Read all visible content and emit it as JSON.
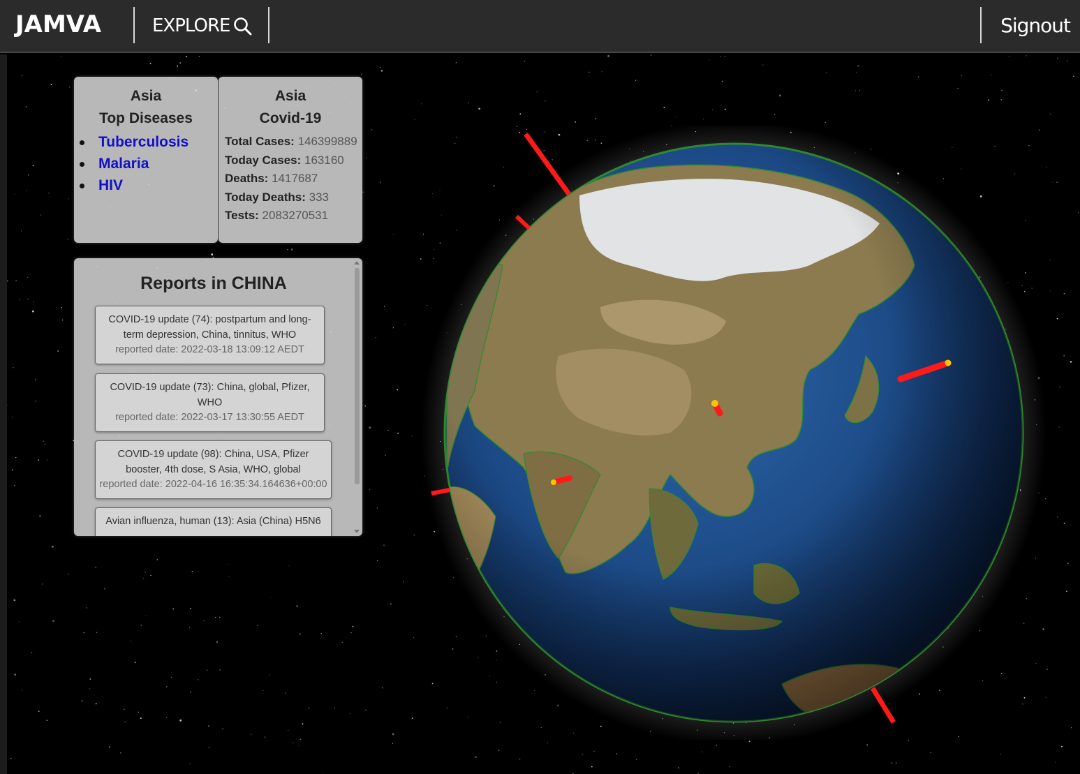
{
  "header": {
    "logo": "JAMVA",
    "explore_label": "EXPLORE",
    "signout_label": "Signout"
  },
  "diseases_panel": {
    "region": "Asia",
    "heading": "Top Diseases",
    "items": [
      "Tuberculosis",
      "Malaria",
      "HIV"
    ]
  },
  "covid_panel": {
    "region": "Asia",
    "heading": "Covid-19",
    "stats": [
      {
        "label": "Total Cases:",
        "value": "146399889"
      },
      {
        "label": "Today Cases:",
        "value": "163160"
      },
      {
        "label": "Deaths:",
        "value": "1417687"
      },
      {
        "label": "Today Deaths:",
        "value": "333"
      },
      {
        "label": "Tests:",
        "value": "2083270531"
      }
    ]
  },
  "reports_panel": {
    "title": "Reports in CHINA",
    "reports": [
      {
        "line1": "COVID-19 update (74): postpartum and long-",
        "line2": "term depression, China, tinnitus, WHO",
        "date": "reported date: 2022-03-18 13:09:12 AEDT"
      },
      {
        "line1": "COVID-19 update (73): China, global, Pfizer,",
        "line2": "WHO",
        "date": "reported date: 2022-03-17 13:30:55 AEDT"
      },
      {
        "line1": "COVID-19 update (98): China, USA, Pfizer",
        "line2": "booster, 4th dose, S Asia, WHO, global",
        "date": "reported date: 2022-04-16 16:35:34.164636+00:00"
      },
      {
        "line1": "Avian influenza, human (13): Asia (China) H5N6",
        "line2": "",
        "date": ""
      }
    ]
  },
  "colors": {
    "topbar": "#2b2b2b",
    "link": "#1010c8",
    "spike": "#ff1a1a",
    "spike_tip": "#ffc400",
    "ocean": "#1d4d8a",
    "land": "#8a7a4e",
    "snow": "#e6e9ec"
  }
}
